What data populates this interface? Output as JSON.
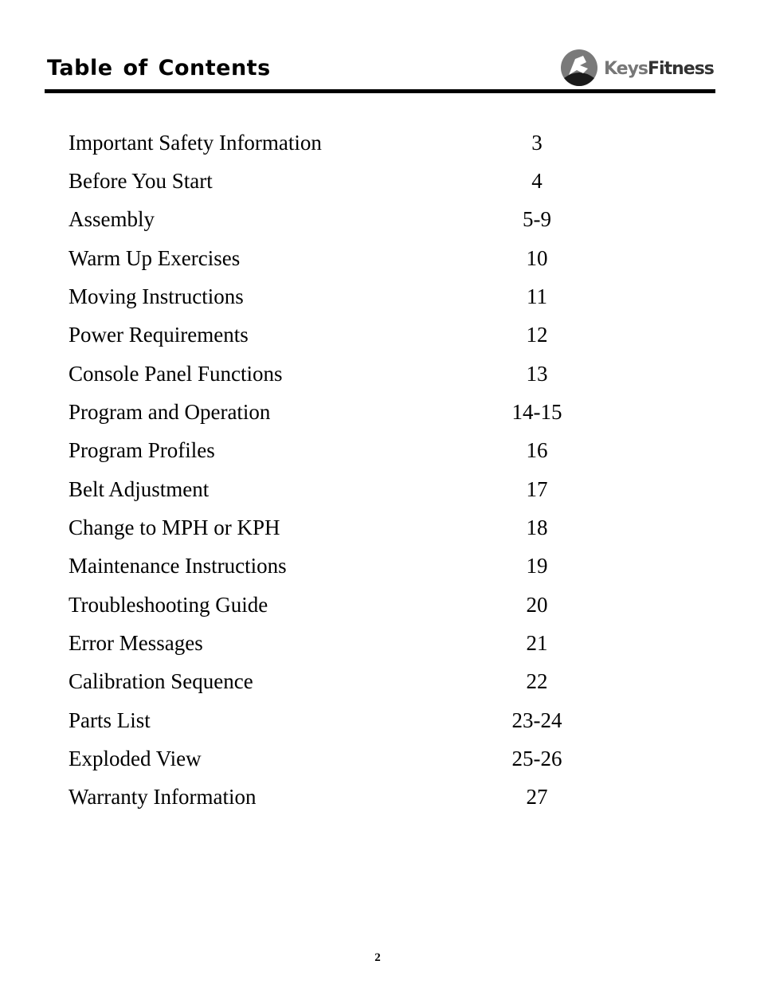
{
  "header": {
    "title": "Table of Contents",
    "logo": {
      "icon": "keys-fitness-runner-logo-icon",
      "brand_part1": "Keys",
      "brand_part2": "Fitness"
    }
  },
  "toc": [
    {
      "label": "Important Safety Information",
      "page": "3"
    },
    {
      "label": "Before You Start",
      "page": "4"
    },
    {
      "label": "Assembly",
      "page": "5-9"
    },
    {
      "label": "Warm Up Exercises",
      "page": "10"
    },
    {
      "label": "Moving Instructions",
      "page": "11"
    },
    {
      "label": "Power Requirements",
      "page": "12"
    },
    {
      "label": "Console Panel Functions",
      "page": "13"
    },
    {
      "label": "Program and Operation",
      "page": "14-15"
    },
    {
      "label": "Program Profiles",
      "page": "16"
    },
    {
      "label": "Belt Adjustment",
      "page": "17"
    },
    {
      "label": "Change to MPH or KPH",
      "page": "18"
    },
    {
      "label": "Maintenance Instructions",
      "page": "19"
    },
    {
      "label": "Troubleshooting Guide",
      "page": "20"
    },
    {
      "label": "Error Messages",
      "page": "21"
    },
    {
      "label": "Calibration Sequence",
      "page": "22"
    },
    {
      "label": "Parts List",
      "page": "23-24"
    },
    {
      "label": "Exploded View",
      "page": "25-26"
    },
    {
      "label": "Warranty Information",
      "page": "27"
    }
  ],
  "footer": {
    "page_number": "2"
  }
}
